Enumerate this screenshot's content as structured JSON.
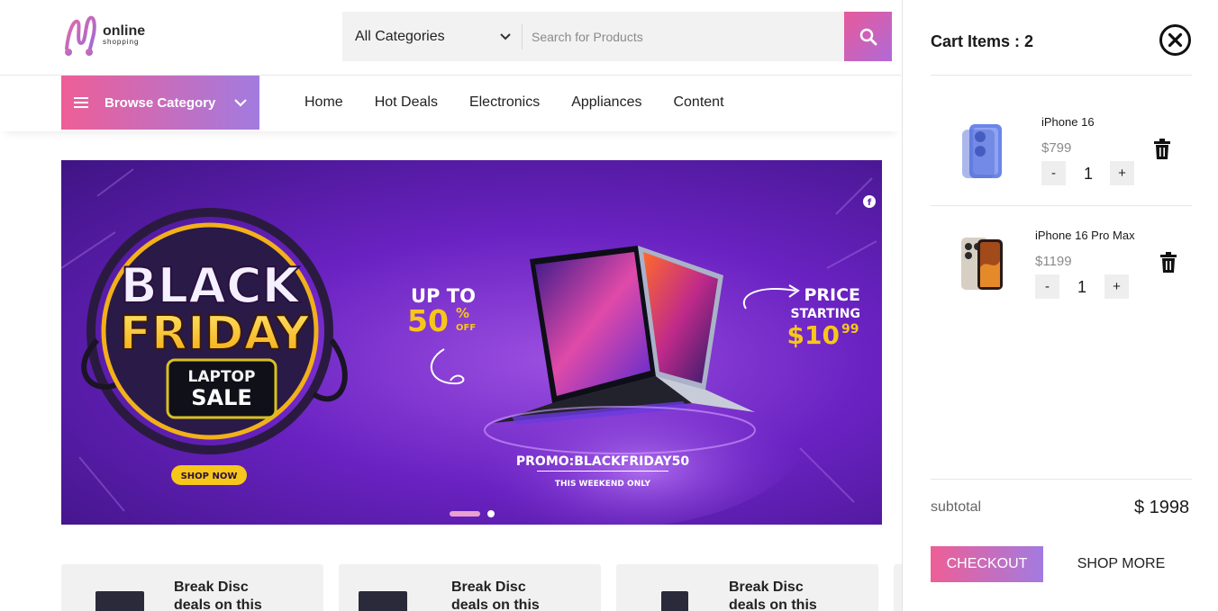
{
  "logo": {
    "line1": "online",
    "line2": "shopping"
  },
  "search": {
    "category": "All Categories",
    "placeholder": "Search for Products"
  },
  "nav": {
    "browse_label": "Browse Category",
    "links": [
      "Home",
      "Hot Deals",
      "Electronics",
      "Appliances",
      "Content"
    ]
  },
  "banner": {
    "headline1": "BLACK",
    "headline2": "FRIDAY",
    "sub1": "LAPTOP",
    "sub2": "SALE",
    "shop_now": "SHOP NOW",
    "upto": "UP TO",
    "discount": "50",
    "percent": "%",
    "off": "OFF",
    "price_label": "PRICE",
    "starting": "STARTING",
    "price": "$10",
    "cents": "99",
    "promo": "PROMO:BLACKFRIDAY50",
    "weekend": "THIS WEEKEND ONLY",
    "slide_active": 1,
    "slide_count": 2
  },
  "cards": [
    {
      "line1": "Break Disc",
      "line2": "deals on this"
    },
    {
      "line1": "Break Disc",
      "line2": "deals on this"
    },
    {
      "line1": "Break Disc",
      "line2": "deals on this"
    }
  ],
  "cart": {
    "title": "Cart Items : 2",
    "items": [
      {
        "name": "iPhone 16",
        "price": "$799",
        "qty": "1",
        "minus": "-",
        "plus": "+"
      },
      {
        "name": "iPhone 16 Pro Max",
        "price": "$1199",
        "qty": "1",
        "minus": "-",
        "plus": "+"
      }
    ],
    "subtotal_label": "subtotal",
    "subtotal_value": "$ 1998",
    "checkout_label": "CHECKOUT",
    "shop_more_label": "SHOP MORE"
  },
  "colors": {
    "accent_pink": "#ee5e96",
    "accent_purple": "#a27be0",
    "banner_purple": "#6a22c2",
    "banner_yellow": "#f7c61a"
  }
}
